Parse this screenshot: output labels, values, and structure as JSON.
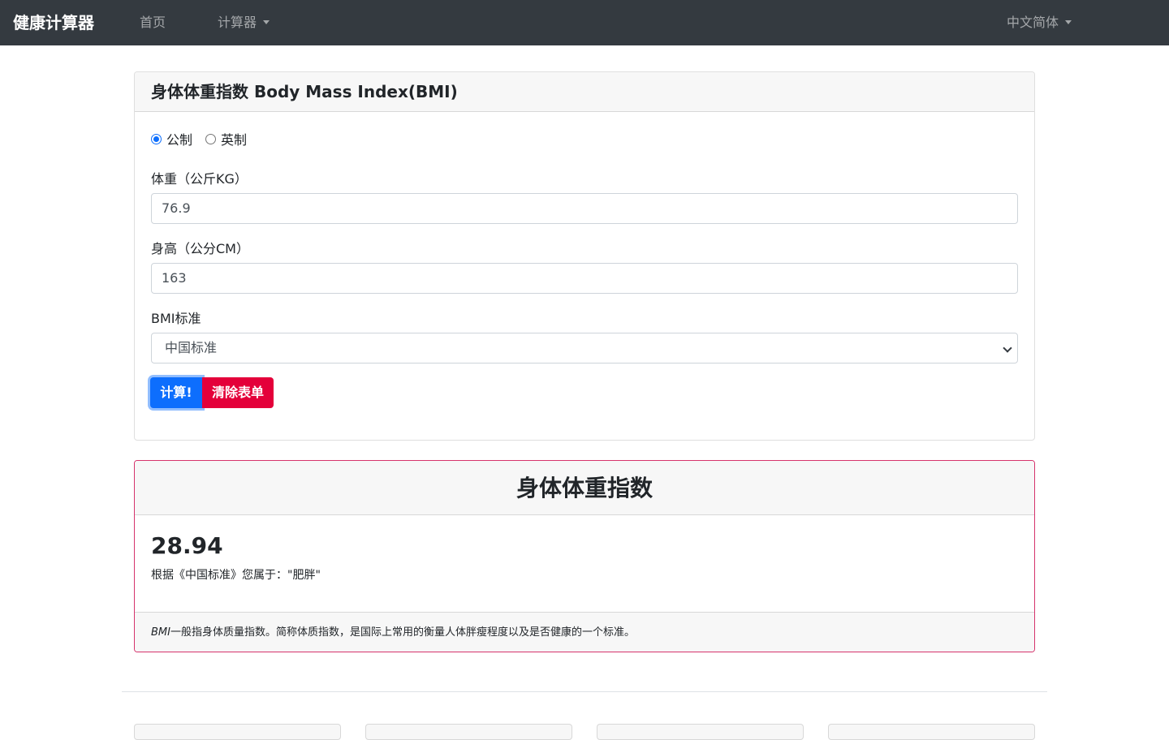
{
  "navbar": {
    "brand": "健康计算器",
    "home": "首页",
    "calculators": "计算器",
    "language": "中文简体"
  },
  "form_card": {
    "title": "身体体重指数 Body Mass Index(BMI)",
    "units": [
      {
        "label": "公制",
        "checked": true
      },
      {
        "label": "英制",
        "checked": false
      }
    ],
    "weight_label": "体重（公斤KG）",
    "weight_value": "76.9",
    "height_label": "身高（公分CM）",
    "height_value": "163",
    "standard_label": "BMI标准",
    "standard_value": "中国标准",
    "calculate_label": "计算!",
    "clear_label": "清除表单"
  },
  "result_card": {
    "title": "身体体重指数",
    "value": "28.94",
    "description": "根据《中国标准》您属于：\"肥胖\"",
    "footer_term": "BMI",
    "footer_text": "一般指身体质量指数。简称体质指数，是国际上常用的衡量人体胖瘦程度以及是否健康的一个标准。"
  },
  "colors": {
    "navbar": "#343a40",
    "primary": "#0d6efd",
    "danger": "#e4003a",
    "result_border": "#d6336c"
  }
}
